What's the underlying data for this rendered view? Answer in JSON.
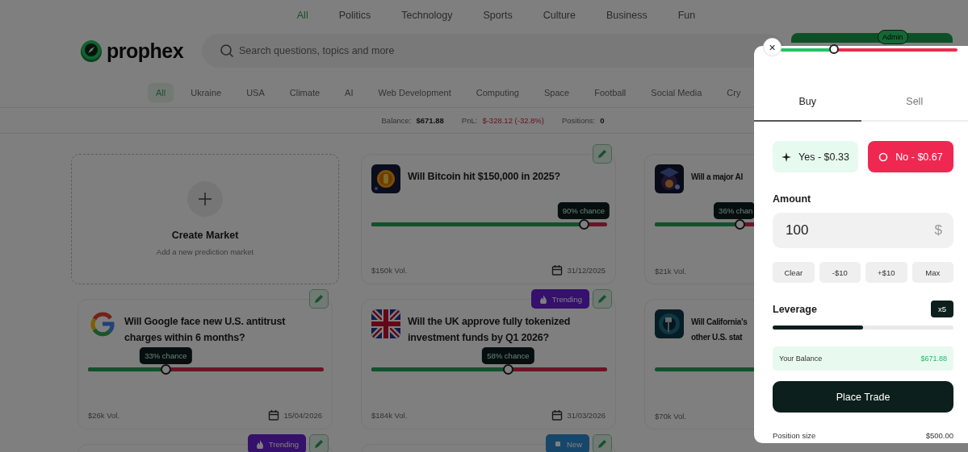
{
  "top_nav": [
    {
      "label": "All",
      "selected": true
    },
    {
      "label": "Politics",
      "selected": false
    },
    {
      "label": "Technology",
      "selected": false
    },
    {
      "label": "Sports",
      "selected": false
    },
    {
      "label": "Culture",
      "selected": false
    },
    {
      "label": "Business",
      "selected": false
    },
    {
      "label": "Fun",
      "selected": false
    }
  ],
  "header": {
    "logo": "prophex",
    "search": {
      "placeholder": "Search questions, topics and more"
    },
    "admin_badge": "Admin"
  },
  "categories": [
    {
      "label": "All",
      "selected": true
    },
    {
      "label": "Ukraine",
      "selected": false
    },
    {
      "label": "USA",
      "selected": false
    },
    {
      "label": "Climate",
      "selected": false
    },
    {
      "label": "AI",
      "selected": false
    },
    {
      "label": "Web Development",
      "selected": false
    },
    {
      "label": "Computing",
      "selected": false
    },
    {
      "label": "Space",
      "selected": false
    },
    {
      "label": "Football",
      "selected": false
    },
    {
      "label": "Social Media",
      "selected": false
    },
    {
      "label": "Cry",
      "selected": false
    }
  ],
  "stats": [
    {
      "label": "Balance:",
      "value": "$671.88",
      "kind": "neutral"
    },
    {
      "label": "PnL:",
      "value": "$-328.12 (-32.8%)",
      "kind": "negative"
    },
    {
      "label": "Positions:",
      "value": "0",
      "kind": "neutral"
    }
  ],
  "create_card": {
    "title": "Create Market",
    "subtitle": "Add a new prediction market"
  },
  "markets": [
    {
      "thumb": {
        "kind": "coin"
      },
      "title": "Will Bitcoin hit $150,000 in 2025?",
      "chance": "90% chance",
      "level": 0.9,
      "volume": "$150k Vol.",
      "date": "31/12/2025",
      "edit_button": true
    },
    {
      "title": "Will a major AI",
      "chance": "36% chan",
      "level": 0.36,
      "volume": "$21k Vol."
    },
    {
      "thumb": {
        "kind": "g-logo"
      },
      "title": "Will Google face new U.S. antitrust charges within 6 months?",
      "chance": "33% chance",
      "level": 0.33,
      "volume": "$26k Vol.",
      "date": "15/04/2026",
      "edit_button": true
    },
    {
      "thumb": {
        "kind": "flag"
      },
      "title": "Will the UK approve fully tokenized investment funds by Q1 2026?",
      "chance": "58% chance",
      "level": 0.58,
      "volume": "$184k Vol.",
      "date": "31/03/2026",
      "badge": {
        "kind": "trending",
        "label": "Trending"
      },
      "edit_button": true
    },
    {
      "title": "Will California’s other U.S. stat",
      "bar": {
        "kind": "yes"
      },
      "volume": "$70k Vol."
    },
    {
      "badge": {
        "kind": "trending",
        "label": "Trending"
      },
      "edit_button": true
    },
    {
      "badge": {
        "kind": "new",
        "label": "New"
      },
      "edit_button": true
    }
  ],
  "trade_panel": {
    "close": "×",
    "price": {
      "level": 0.3
    },
    "tabs": [
      {
        "label": "Buy",
        "selected": true
      },
      {
        "label": "Sell",
        "selected": false
      }
    ],
    "outcomes": [
      {
        "kind": "yes",
        "label": "Yes - $0.33",
        "selected": false
      },
      {
        "kind": "no",
        "label": "No - $0.67",
        "selected": true
      }
    ],
    "amount": {
      "label": "Amount",
      "value": "100",
      "unit": "$"
    },
    "quick_amounts": [
      "Clear",
      "-$10",
      "+$10",
      "Max"
    ],
    "leverage": {
      "label": "Leverage",
      "value": "x5",
      "level": 0.5
    },
    "balance": {
      "label": "Your Balance",
      "value": "$671.88"
    },
    "submit": "Place Trade",
    "summary": [
      {
        "label": "Position size",
        "value": "$500.00"
      }
    ]
  }
}
